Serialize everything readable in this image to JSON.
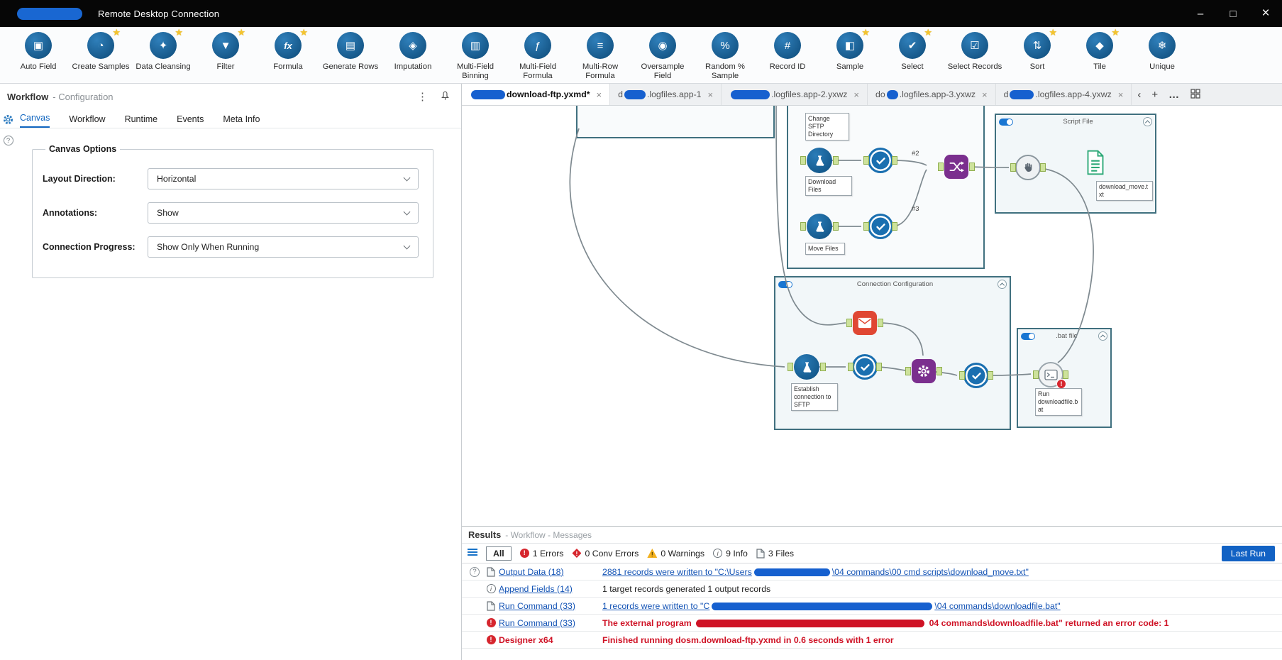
{
  "titlebar": {
    "title": "Remote Desktop Connection",
    "controls": {
      "minimize": "–",
      "maximize": "□",
      "close": "×"
    }
  },
  "toolbar": {
    "star": "★",
    "tools": [
      {
        "label": "Auto Field",
        "glyph": "▣"
      },
      {
        "label": "Create Samples",
        "glyph": "◔"
      },
      {
        "label": "Data Cleansing",
        "glyph": "✦"
      },
      {
        "label": "Filter",
        "glyph": "▼"
      },
      {
        "label": "Formula",
        "glyph": "fx"
      },
      {
        "label": "Generate Rows",
        "glyph": "▤"
      },
      {
        "label": "Imputation",
        "glyph": "◈"
      },
      {
        "label": "Multi-Field Binning",
        "glyph": "▥"
      },
      {
        "label": "Multi-Field Formula",
        "glyph": "ƒ"
      },
      {
        "label": "Multi-Row Formula",
        "glyph": "≡"
      },
      {
        "label": "Oversample Field",
        "glyph": "◉"
      },
      {
        "label": "Random % Sample",
        "glyph": "%"
      },
      {
        "label": "Record ID",
        "glyph": "#"
      },
      {
        "label": "Sample",
        "glyph": "◧"
      },
      {
        "label": "Select",
        "glyph": "✔"
      },
      {
        "label": "Select Records",
        "glyph": "☑"
      },
      {
        "label": "Sort",
        "glyph": "⇅"
      },
      {
        "label": "Tile",
        "glyph": "◆"
      },
      {
        "label": "Unique",
        "glyph": "❄"
      }
    ]
  },
  "config_panel": {
    "title": "Workflow",
    "subtitle": "- Configuration",
    "kebab": "⋮",
    "help": "?",
    "tabs": [
      {
        "label": "Canvas"
      },
      {
        "label": "Workflow"
      },
      {
        "label": "Runtime"
      },
      {
        "label": "Events"
      },
      {
        "label": "Meta Info"
      }
    ],
    "group_title": "Canvas Options",
    "fields": [
      {
        "label": "Layout Direction:",
        "value": "Horizontal"
      },
      {
        "label": "Annotations:",
        "value": "Show"
      },
      {
        "label": "Connection Progress:",
        "value": "Show Only When Running"
      }
    ]
  },
  "workflow_tabs": {
    "tabs": [
      {
        "prefix": "",
        "suffix": "download-ftp.yxmd*",
        "close": "×"
      },
      {
        "prefix": "d",
        "suffix": ".logfiles.app-1",
        "close": "×"
      },
      {
        "prefix": "",
        "suffix": ".logfiles.app-2.yxwz",
        "close": "×"
      },
      {
        "prefix": "do",
        "suffix": ".logfiles.app-3.yxwz",
        "close": "×"
      },
      {
        "prefix": "d",
        "suffix": ".logfiles.app-4.yxwz",
        "close": "×"
      }
    ],
    "overflow": "‹",
    "add": "+",
    "more": "…"
  },
  "canvas": {
    "containers": {
      "script_file": "Script File",
      "connection_config": "Connection Configuration",
      "bat_file": ".bat file"
    },
    "annotations": {
      "change_sftp": "Change SFTP Directory",
      "download_files": "Download Files",
      "move_files": "Move Files",
      "download_move": "download_move.txt",
      "establish": "Establish connection to SFTP",
      "run_bat": "Run downloadfile.bat"
    },
    "wire_labels": {
      "two": "#2",
      "three": "#3"
    },
    "cmd_badge": "!"
  },
  "results": {
    "title": "Results",
    "subtitle": "- Workflow - Messages",
    "icons": {
      "error": "!",
      "conv": "!",
      "warn": "!",
      "info": "i",
      "help": "?"
    },
    "filters": {
      "all": "All",
      "errors": "1 Errors",
      "conv_errors": "0 Conv Errors",
      "warnings": "0 Warnings",
      "info": "9 Info",
      "files": "3 Files"
    },
    "last_run": "Last Run",
    "rows": [
      {
        "source": "Output Data (18)",
        "pre": "2881 records were written to \"C:\\Users",
        "post": "\\04 commands\\00 cmd scripts\\download_move.txt\""
      },
      {
        "source": "Append Fields (14)",
        "pre": "1 target records generated 1 output records",
        "post": ""
      },
      {
        "source": "Run Command (33)",
        "pre": "1 records were written to \"C",
        "post": "\\04 commands\\downloadfile.bat\""
      },
      {
        "source": "Run Command (33)",
        "pre": "The external program ",
        "post": " 04 commands\\downloadfile.bat\" returned an error code: 1"
      },
      {
        "source": "Designer x64",
        "pre": "Finished running dosm.download-ftp.yxmd in 0.6 seconds with 1 error",
        "post": ""
      }
    ]
  }
}
